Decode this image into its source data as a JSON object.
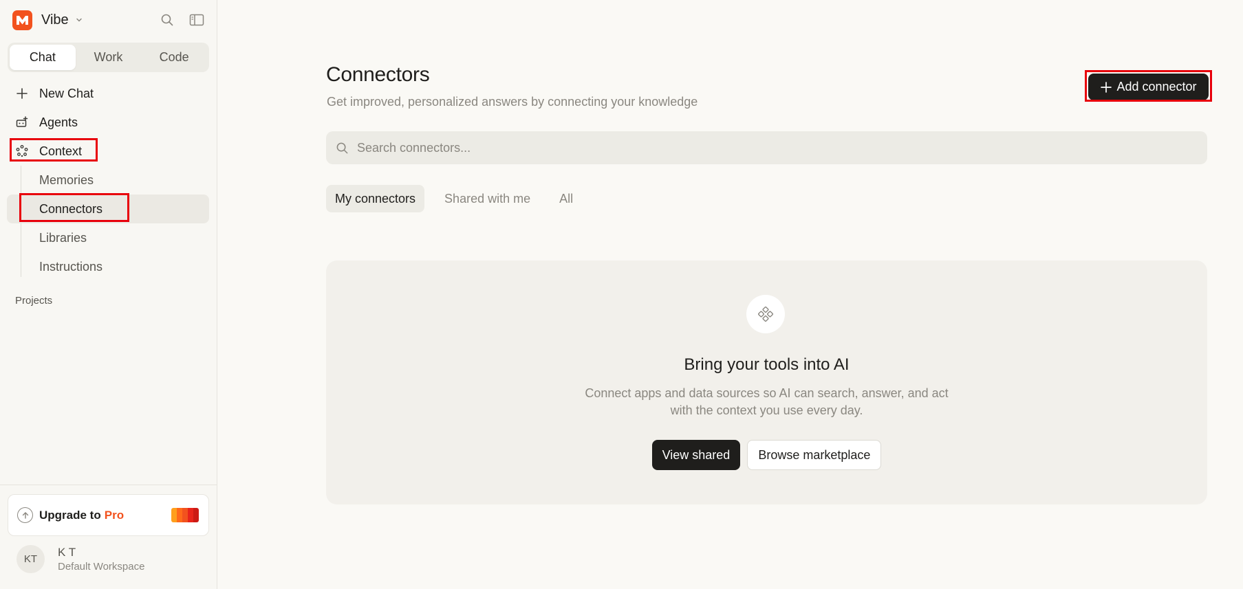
{
  "brand": {
    "name": "Vibe",
    "logo_color": "#f2521e"
  },
  "mode_tabs": [
    {
      "label": "Chat",
      "active": true
    },
    {
      "label": "Work",
      "active": false
    },
    {
      "label": "Code",
      "active": false
    }
  ],
  "nav": {
    "new_chat": "New Chat",
    "agents": "Agents",
    "context": "Context",
    "context_items": [
      {
        "label": "Memories",
        "active": false
      },
      {
        "label": "Connectors",
        "active": true
      },
      {
        "label": "Libraries",
        "active": false
      },
      {
        "label": "Instructions",
        "active": false
      }
    ],
    "projects_label": "Projects"
  },
  "upgrade": {
    "prefix": "Upgrade to",
    "tier": "Pro",
    "swatch_colors": [
      "#ff9f1c",
      "#ff6a1a",
      "#f2521e",
      "#e8241a"
    ]
  },
  "user": {
    "initials": "KT",
    "name": "K T",
    "workspace": "Default Workspace"
  },
  "main": {
    "title": "Connectors",
    "subtitle": "Get improved, personalized answers by connecting your knowledge",
    "add_button": "Add connector",
    "search_placeholder": "Search connectors...",
    "filter_tabs": [
      {
        "label": "My connectors",
        "active": true
      },
      {
        "label": "Shared with me",
        "active": false
      },
      {
        "label": "All",
        "active": false
      }
    ],
    "empty": {
      "title": "Bring your tools into AI",
      "description": "Connect apps and data sources so AI can search, answer, and act with the context you use every day.",
      "primary_button": "View shared",
      "secondary_button": "Browse marketplace"
    }
  },
  "colors": {
    "accent": "#f2521e",
    "highlight": "#e8000b",
    "dark": "#1f1e1c"
  }
}
